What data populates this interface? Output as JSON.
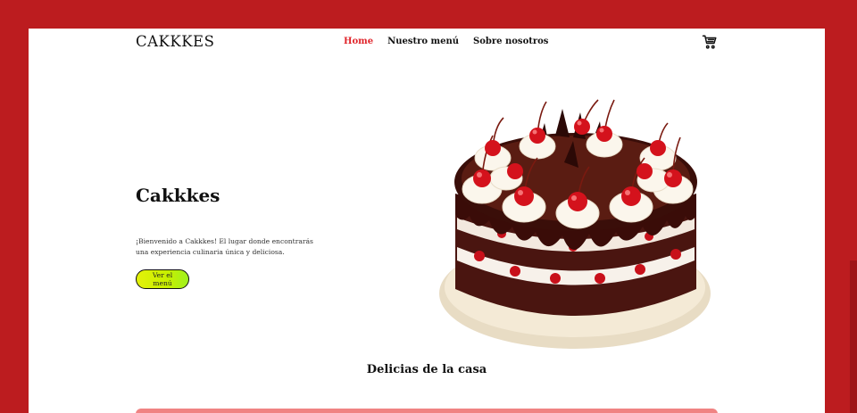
{
  "header": {
    "logo": "CAKKKES",
    "nav": [
      {
        "label": "Home",
        "active": true
      },
      {
        "label": "Nuestro menú",
        "active": false
      },
      {
        "label": "Sobre nosotros",
        "active": false
      }
    ],
    "cart_icon": "shopping-cart-icon"
  },
  "hero": {
    "title": "Cakkkes",
    "description": "¡Bienvenido a Cakkkes! El lugar donde encontrarás una experiencia culinaria única y deliciosa.",
    "button_label": "Ver el menú",
    "image": "black-forest-cake-image"
  },
  "section": {
    "title": "Delicias de la casa"
  },
  "colors": {
    "frame": "#bc1c1f",
    "nav_active": "#e0252b",
    "button": "#d4f000",
    "pink_bar": "#f08383"
  }
}
